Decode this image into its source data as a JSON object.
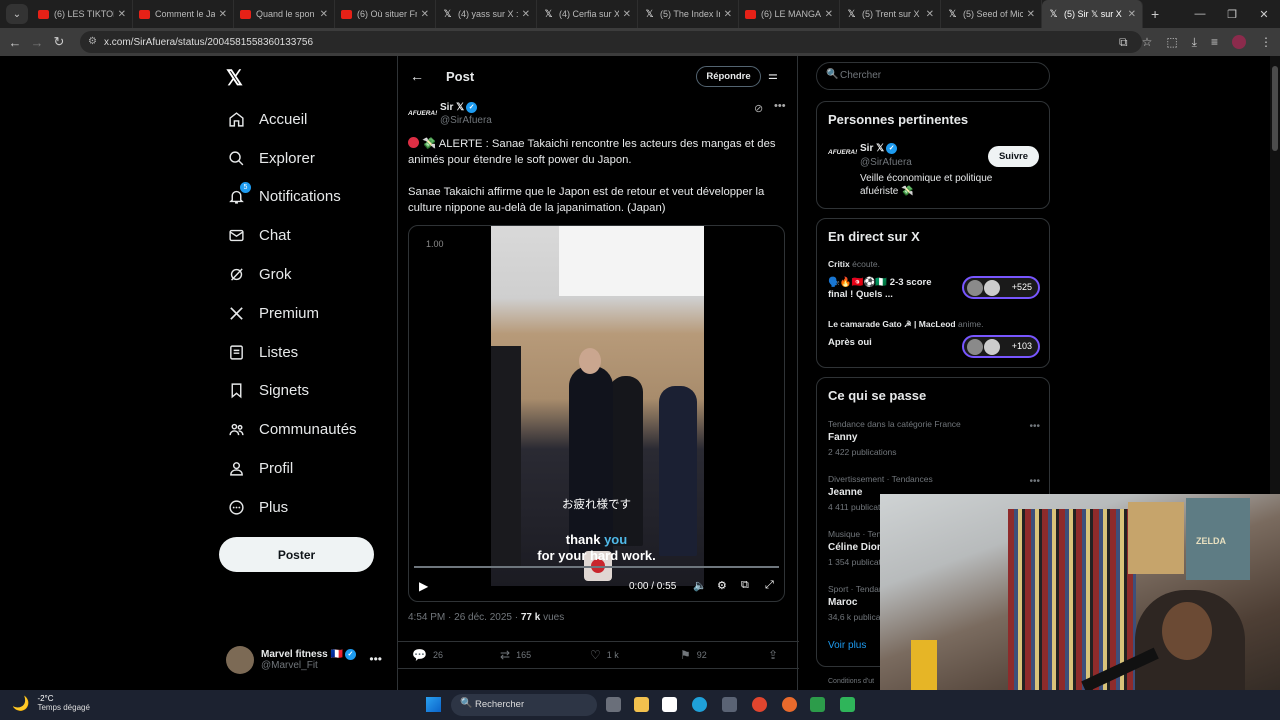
{
  "browser": {
    "tabs": [
      {
        "label": "(6) LES TIKTOK",
        "icon": "youtube-icon"
      },
      {
        "label": "Comment le Ja",
        "icon": "youtube-icon"
      },
      {
        "label": "Quand le spon",
        "icon": "youtube-icon"
      },
      {
        "label": "(6) Où situer Fr",
        "icon": "youtube-icon"
      },
      {
        "label": "(4) yass sur X :",
        "icon": "x-icon"
      },
      {
        "label": "(4) Cerfia sur X",
        "icon": "x-icon"
      },
      {
        "label": "(5) The Index In",
        "icon": "x-icon"
      },
      {
        "label": "(6) LE MANGA",
        "icon": "youtube-icon"
      },
      {
        "label": "(5) Trent sur X",
        "icon": "x-icon"
      },
      {
        "label": "(5) Seed of Mic",
        "icon": "x-icon"
      },
      {
        "label": "(5) Sir 𝕏 sur X",
        "icon": "x-icon",
        "active": true
      }
    ],
    "url": "x.com/SirAfuera/status/2004581558360133756"
  },
  "sidebar": {
    "logo": "𝕏",
    "items": [
      {
        "label": "Accueil",
        "icon": "home-icon"
      },
      {
        "label": "Explorer",
        "icon": "search-icon"
      },
      {
        "label": "Notifications",
        "icon": "bell-icon",
        "badge": "5"
      },
      {
        "label": "Chat",
        "icon": "mail-icon"
      },
      {
        "label": "Grok",
        "icon": "grok-icon"
      },
      {
        "label": "Premium",
        "icon": "x-icon"
      },
      {
        "label": "Listes",
        "icon": "list-icon"
      },
      {
        "label": "Signets",
        "icon": "bookmark-icon"
      },
      {
        "label": "Communautés",
        "icon": "community-icon"
      },
      {
        "label": "Profil",
        "icon": "profile-icon"
      },
      {
        "label": "Plus",
        "icon": "more-icon"
      }
    ],
    "post_label": "Poster",
    "account": {
      "name": "Marvel fitness 🇫🇷",
      "handle": "@Marvel_Fit"
    }
  },
  "main": {
    "title": "Post",
    "reply_label": "Répondre",
    "author": {
      "avatar_text": "AFUERA!",
      "name": "Sir 𝕏",
      "handle": "@SirAfuera"
    },
    "text1": "💸 ALERTE : Sanae Takaichi rencontre les acteurs des mangas et des animés pour étendre le soft power du Japon.",
    "text2": "Sanae Takaichi affirme que le Japon est de retour et veut développer la culture nippone au-delà de la japanimation. (Japan)",
    "video": {
      "speed": "1.00",
      "subtitle_jp": "お疲れ様です",
      "subtitle_en_a": "thank ",
      "subtitle_en_b": "you",
      "subtitle_en_c": "for your hard work.",
      "time": "0:00 / 0:55",
      "progress": 0
    },
    "meta_time": "4:54 PM · 26 déc. 2025 · ",
    "meta_views": "77 k",
    "meta_views_label": " vues",
    "actions": {
      "replies": "26",
      "reposts": "165",
      "likes": "1 k",
      "bookmarks": "92"
    }
  },
  "right": {
    "search_placeholder": "Chercher",
    "relevant": {
      "title": "Personnes pertinentes",
      "avatar_text": "AFUERA!",
      "name": "Sir 𝕏",
      "handle": "@SirAfuera",
      "bio": "Veille économique et politique afuériste 💸",
      "follow_label": "Suivre"
    },
    "live": {
      "title": "En direct sur X",
      "spaces": [
        {
          "host": "Critix",
          "status": "écoute.",
          "title": "🗣️🔥🇹🇳⚽🇳🇬 2-3 score final ! Quels ...",
          "count": "+525"
        },
        {
          "host": "Le camarade Gato ☭ | MacLeod",
          "status": "anime.",
          "title": "Après oui",
          "count": "+103"
        }
      ]
    },
    "trends": {
      "title": "Ce qui se passe",
      "items": [
        {
          "category": "Tendance dans la catégorie France",
          "keyword": "Fanny",
          "count": "2 422 publications"
        },
        {
          "category": "Divertissement · Tendances",
          "keyword": "Jeanne",
          "count": "4 411 publications"
        },
        {
          "category": "Musique · Tendances",
          "keyword": "Céline Dion",
          "count": "1 354 publications"
        },
        {
          "category": "Sport · Tendances",
          "keyword": "Maroc",
          "count": "34,6 k publications"
        }
      ],
      "see_more": "Voir plus"
    },
    "conditions": "Conditions d'ut"
  },
  "webcam": {
    "poster_text": "ZELDA"
  },
  "taskbar": {
    "temp": "-2°C",
    "weather": "Temps dégagé",
    "search_placeholder": "Rechercher"
  },
  "colors": {
    "accent": "#1d9bf0",
    "background": "#000000",
    "muted": "#71767b",
    "youtube": "#e62117"
  }
}
